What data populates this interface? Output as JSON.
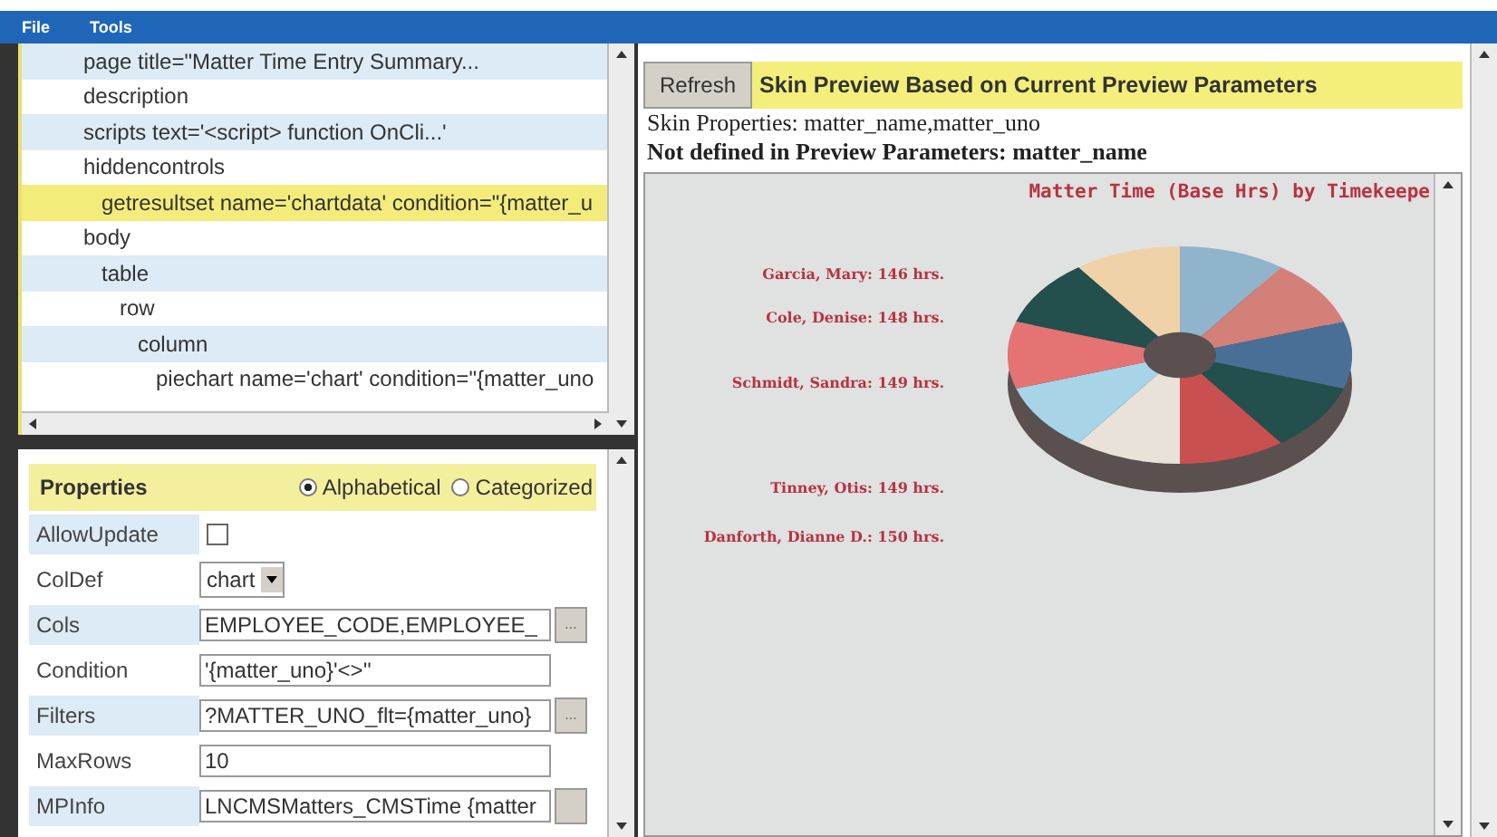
{
  "menu": [
    "File",
    "Tools"
  ],
  "tree": [
    {
      "label": "page title=\"Matter Time Entry Summary...",
      "selected": false
    },
    {
      "label": "description",
      "selected": false
    },
    {
      "label": "scripts text='<script> function OnCli...'",
      "selected": false
    },
    {
      "label": "hiddencontrols",
      "selected": false,
      "children": [
        {
          "label": "getresultset name='chartdata' condition=\"{matter_u",
          "selected": true
        }
      ]
    },
    {
      "label": "body",
      "selected": false,
      "children": [
        {
          "label": "table",
          "selected": false,
          "children": [
            {
              "label": "row",
              "selected": false,
              "children": [
                {
                  "label": "column",
                  "selected": false,
                  "children": [
                    {
                      "label": "piechart name='chart' condition=\"{matter_uno",
                      "selected": false
                    }
                  ]
                }
              ]
            }
          ]
        }
      ]
    }
  ],
  "properties": {
    "title": "Properties",
    "sort": [
      {
        "label": "Alphabetical",
        "selected": true
      },
      {
        "label": "Categorized",
        "selected": false
      }
    ],
    "rows": [
      {
        "name": "AllowUpdate",
        "kind": "checkbox",
        "checked": false
      },
      {
        "name": "ColDef",
        "kind": "select",
        "value": "chart"
      },
      {
        "name": "Cols",
        "kind": "picker",
        "value": "EMPLOYEE_CODE,EMPLOYEE_",
        "button": "..."
      },
      {
        "name": "Condition",
        "kind": "text",
        "value": "'{matter_uno}'<>''"
      },
      {
        "name": "Filters",
        "kind": "picker",
        "value": "?MATTER_UNO_flt={matter_uno}",
        "button": "..."
      },
      {
        "name": "MaxRows",
        "kind": "text",
        "value": "10"
      },
      {
        "name": "MPInfo",
        "kind": "picker",
        "value": "LNCMSMatters_CMSTime {matter",
        "button": ""
      }
    ]
  },
  "preview": {
    "refresh": "Refresh",
    "title": "Skin Preview Based on Current Preview Parameters",
    "skin_properties": "Skin Properties: matter_name,matter_uno",
    "not_defined": "Not defined in Preview Parameters: matter_name",
    "chart_title": "Matter Time (Base Hrs)  by Timekeepe",
    "labels": [
      "Garcia, Mary: 146 hrs.",
      "Cole, Denise: 148 hrs.",
      "Schmidt, Sandra: 149 hrs.",
      "Tinney, Otis: 149 hrs.",
      "Danforth, Dianne D.: 150 hrs."
    ]
  }
}
